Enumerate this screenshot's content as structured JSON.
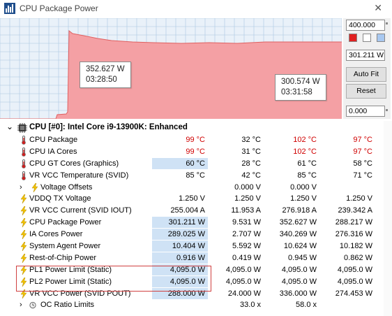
{
  "window": {
    "title": "CPU Package Power",
    "close_symbol": "✕"
  },
  "graph": {
    "fill_color": "#f4a0a4",
    "line_color": "#e06060",
    "grid_color": "#a9c8e0",
    "background": "#e9f1f9",
    "tooltip_a": {
      "value": "352.627 W",
      "time": "03:28:50"
    },
    "tooltip_b": {
      "value": "300.574 W",
      "time": "03:31:58"
    }
  },
  "panel": {
    "max_value": "400.000",
    "current_value": "301.211 W",
    "min_value": "0.000",
    "auto_fit_label": "Auto Fit",
    "reset_label": "Reset",
    "swatch_colors": [
      "#e02020",
      "#ffffff",
      "#a8c8f0"
    ]
  },
  "header": {
    "toggle": "⌄",
    "label": "CPU [#0]: Intel Core i9-13900K: Enhanced"
  },
  "rows": [
    {
      "icon": "thermometer",
      "label": "CPU Package",
      "current": "99 °C",
      "min": "32 °C",
      "max": "102 °C",
      "avg": "97 °C",
      "red": true,
      "hl": false
    },
    {
      "icon": "thermometer",
      "label": "CPU IA Cores",
      "current": "99 °C",
      "min": "31 °C",
      "max": "102 °C",
      "avg": "97 °C",
      "red": true,
      "hl": false
    },
    {
      "icon": "thermometer",
      "label": "CPU GT Cores (Graphics)",
      "current": "60 °C",
      "min": "28 °C",
      "max": "61 °C",
      "avg": "58 °C",
      "red": false,
      "hl": true
    },
    {
      "icon": "thermometer",
      "label": "VR VCC Temperature (SVID)",
      "current": "85 °C",
      "min": "42 °C",
      "max": "85 °C",
      "avg": "71 °C",
      "red": false,
      "hl": false
    },
    {
      "icon": "bolt",
      "label": "Voltage Offsets",
      "current": "",
      "min": "0.000 V",
      "max": "0.000 V",
      "avg": "",
      "red": false,
      "hl": false,
      "expander": true
    },
    {
      "icon": "bolt",
      "label": "VDDQ TX Voltage",
      "current": "1.250 V",
      "min": "1.250 V",
      "max": "1.250 V",
      "avg": "1.250 V",
      "red": false,
      "hl": false
    },
    {
      "icon": "bolt",
      "label": "VR VCC Current (SVID IOUT)",
      "current": "255.004 A",
      "min": "11.953 A",
      "max": "276.918 A",
      "avg": "239.342 A",
      "red": false,
      "hl": false
    },
    {
      "icon": "bolt",
      "label": "CPU Package Power",
      "current": "301.211 W",
      "min": "9.531 W",
      "max": "352.627 W",
      "avg": "288.217 W",
      "red": false,
      "hl": true
    },
    {
      "icon": "bolt",
      "label": "IA Cores Power",
      "current": "289.025 W",
      "min": "2.707 W",
      "max": "340.269 W",
      "avg": "276.316 W",
      "red": false,
      "hl": true
    },
    {
      "icon": "bolt",
      "label": "System Agent Power",
      "current": "10.404 W",
      "min": "5.592 W",
      "max": "10.624 W",
      "avg": "10.182 W",
      "red": false,
      "hl": true
    },
    {
      "icon": "bolt",
      "label": "Rest-of-Chip Power",
      "current": "0.916 W",
      "min": "0.419 W",
      "max": "0.945 W",
      "avg": "0.862 W",
      "red": false,
      "hl": true
    },
    {
      "icon": "bolt",
      "label": "PL1 Power Limit (Static)",
      "current": "4,095.0 W",
      "min": "4,095.0 W",
      "max": "4,095.0 W",
      "avg": "4,095.0 W",
      "red": false,
      "hl": true
    },
    {
      "icon": "bolt",
      "label": "PL2 Power Limit (Static)",
      "current": "4,095.0 W",
      "min": "4,095.0 W",
      "max": "4,095.0 W",
      "avg": "4,095.0 W",
      "red": false,
      "hl": true
    },
    {
      "icon": "bolt",
      "label": "VR VCC Power (SVID POUT)",
      "current": "288.000 W",
      "min": "24.000 W",
      "max": "336.000 W",
      "avg": "274.453 W",
      "red": false,
      "hl": true
    },
    {
      "icon": "clock",
      "label": "OC Ratio Limits",
      "current": "",
      "min": "33.0 x",
      "max": "58.0 x",
      "avg": "",
      "red": false,
      "hl": false,
      "expander": true
    }
  ]
}
